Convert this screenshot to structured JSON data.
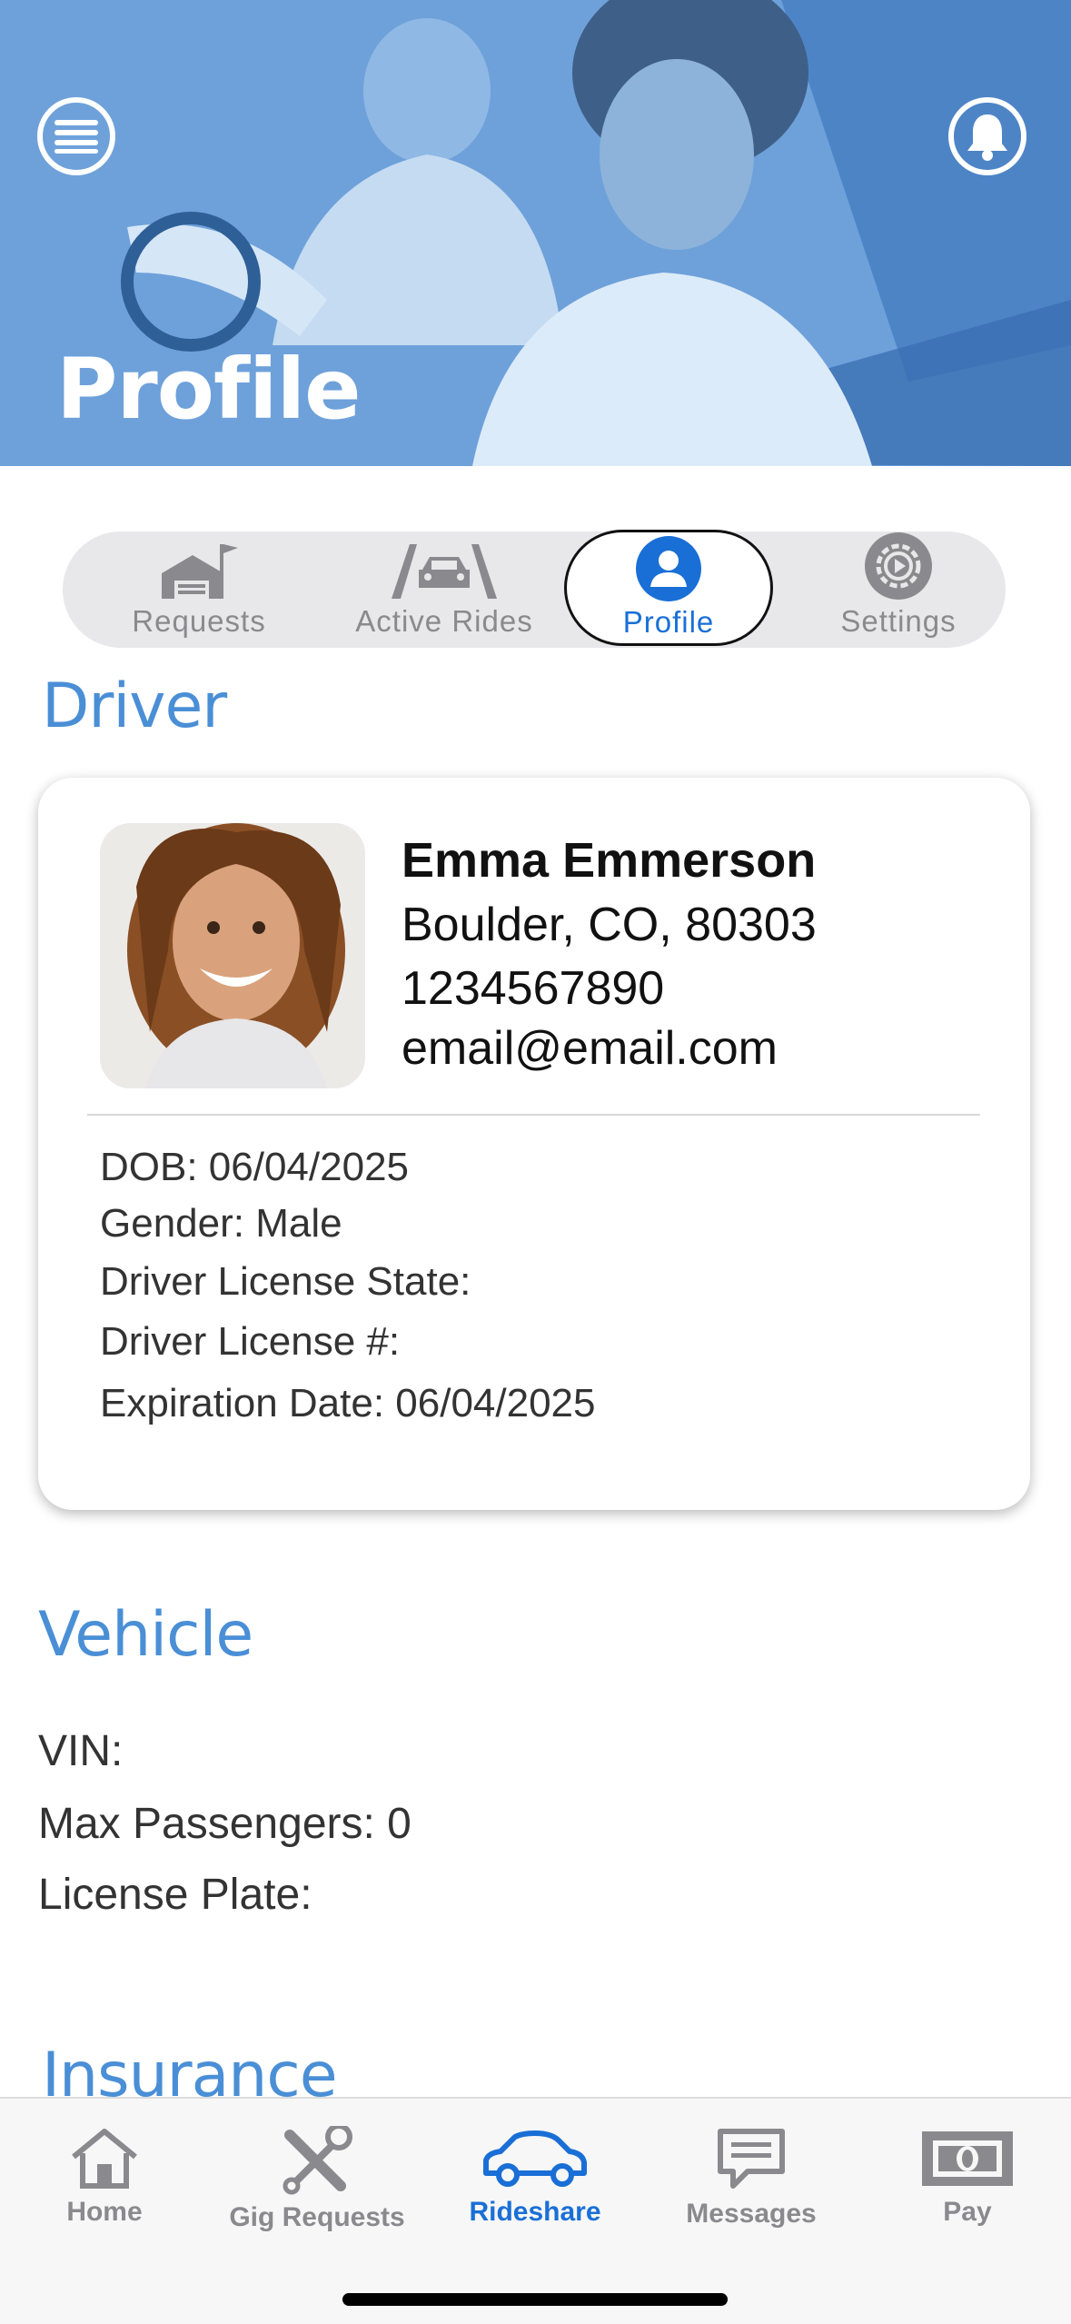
{
  "header": {
    "title": "Profile"
  },
  "segments": [
    {
      "label": "Requests",
      "icon": "garage-flag-icon"
    },
    {
      "label": "Active Rides",
      "icon": "road-car-icon"
    },
    {
      "label": "Profile",
      "icon": "person-icon",
      "active": true
    },
    {
      "label": "Settings",
      "icon": "gear-icon"
    }
  ],
  "driver": {
    "section_title": "Driver",
    "name": "Emma Emmerson",
    "location": "Boulder, CO, 80303",
    "phone": "1234567890",
    "email": "email@email.com",
    "dob": "DOB: 06/04/2025",
    "gender": "Gender: Male",
    "license_state": "Driver License State:",
    "license_number": "Driver License #:",
    "expiration": "Expiration Date: 06/04/2025"
  },
  "vehicle": {
    "section_title": "Vehicle",
    "vin": "VIN:",
    "max_passengers": "Max Passengers: 0",
    "license_plate": "License Plate:"
  },
  "insurance": {
    "section_title": "Insurance"
  },
  "tabbar": [
    {
      "label": "Home",
      "icon": "house-icon"
    },
    {
      "label": "Gig Requests",
      "icon": "tools-icon"
    },
    {
      "label": "Rideshare",
      "icon": "car-icon",
      "active": true
    },
    {
      "label": "Messages",
      "icon": "message-icon"
    },
    {
      "label": "Pay",
      "icon": "money-icon"
    }
  ],
  "colors": {
    "accent": "#1a6fd6",
    "section": "#4a8fd6",
    "hero": "#5f97d3"
  }
}
